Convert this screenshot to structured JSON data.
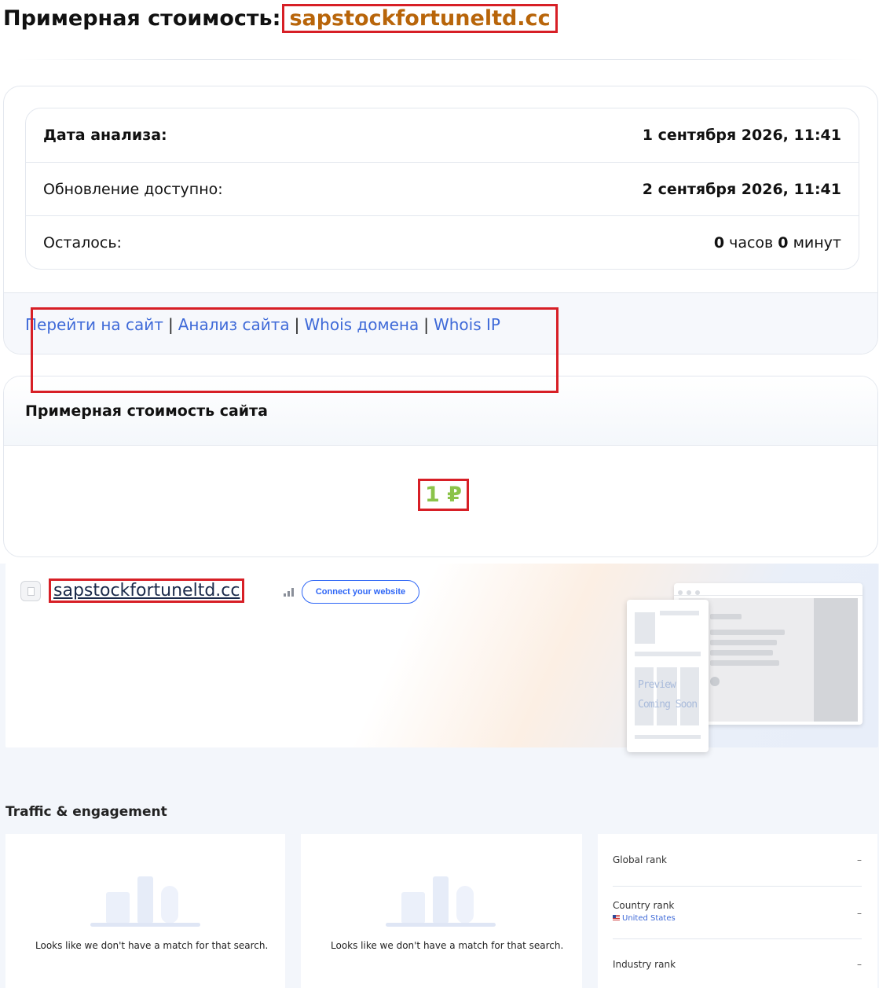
{
  "title": {
    "prefix": "Примерная стоимость:",
    "domain": "sapstockfortuneltd.cc"
  },
  "info": {
    "analysis_date_label": "Дата анализа:",
    "analysis_date_value": "1 сентября 2026, 11:41",
    "update_label": "Обновление доступно:",
    "update_value": "2 сентября 2026, 11:41",
    "remaining_label": "Осталось:",
    "remaining_hours": "0",
    "remaining_hours_unit": "часов",
    "remaining_minutes": "0",
    "remaining_minutes_unit": "минут"
  },
  "links": [
    {
      "label": "Перейти на сайт"
    },
    {
      "label": "Анализ сайта"
    },
    {
      "label": "Whois домена"
    },
    {
      "label": "Whois IP"
    }
  ],
  "links_separator": "|",
  "value_card": {
    "heading": "Примерная стоимость сайта",
    "amount": "1 ₽"
  },
  "similarweb": {
    "domain": "sapstockfortuneltd.cc",
    "connect_button": "Connect your website",
    "preview_line1": "Preview",
    "preview_line2": "Coming Soon",
    "section_title": "Traffic & engagement",
    "no_match_text": "Looks like we don't have a match for that search.",
    "ranks": {
      "global_label": "Global rank",
      "global_value": "–",
      "country_label": "Country rank",
      "country_sub": "United States",
      "country_value": "–",
      "industry_label": "Industry rank",
      "industry_value": "–"
    }
  },
  "colors": {
    "domain_accent": "#b8650a",
    "link": "#3f6ad8",
    "price_green": "#8bc34a",
    "highlight_frame": "#d71f26",
    "connect_blue": "#2e66f6"
  },
  "icons": [
    "favicon-placeholder-icon",
    "bar-chart-icon",
    "us-flag-icon",
    "empty-search-illustration"
  ]
}
